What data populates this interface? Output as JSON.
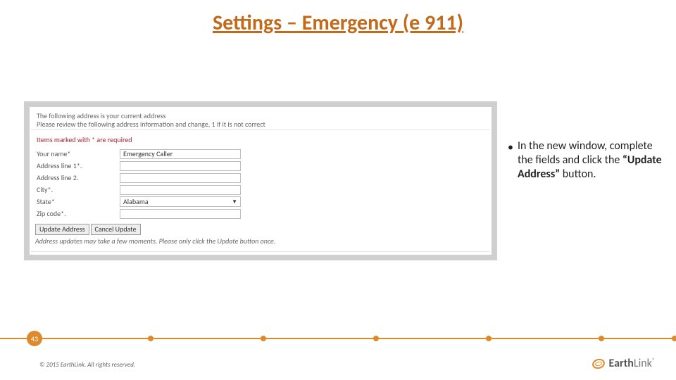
{
  "title": "Settings – Emergency (e 911)",
  "bullet": {
    "prefix": "In the new window, complete the fields and click the ",
    "bold": "“Update Address”",
    "suffix": " button."
  },
  "screenshot": {
    "info1": "The following address is your current address",
    "info2": "Please review the following address information and change, 1 if it is not correct",
    "required_note": "Items marked with * are required",
    "fields": {
      "name_label": "Your name*",
      "name_value": "Emergency Caller",
      "addr1_label": "Address line 1*.",
      "addr1_value": "",
      "addr2_label": "Address line 2.",
      "addr2_value": "",
      "city_label": "City*.",
      "city_value": "",
      "state_label": "State*",
      "state_value": "Alabama",
      "zip_label": "Zip code*.",
      "zip_value": ""
    },
    "buttons": {
      "update": "Update Address",
      "cancel": "Cancel Update"
    },
    "footnote": "Address updates may take a few moments. Please only click the Update button once."
  },
  "footer": {
    "page": "43",
    "copyright": "© 2015 EarthLink. All rights reserved.",
    "logo_bold": "Earth",
    "logo_light": "Link"
  }
}
